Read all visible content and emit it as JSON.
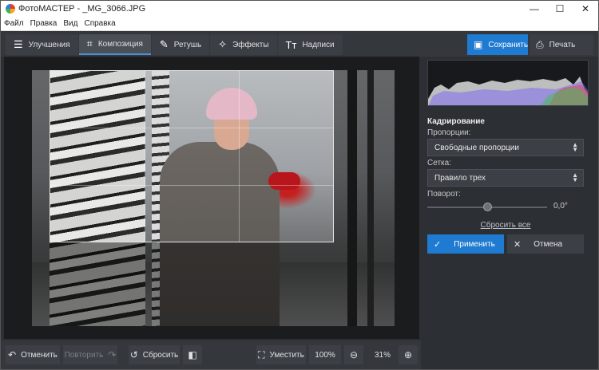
{
  "window": {
    "title": "ФотоМАСТЕР - _MG_3066.JPG",
    "minimize": "—",
    "maximize": "☐",
    "close": "✕"
  },
  "menu": [
    "Файл",
    "Правка",
    "Вид",
    "Справка"
  ],
  "tabs": [
    {
      "label": "Улучшения",
      "icon": "sliders-icon"
    },
    {
      "label": "Композиция",
      "icon": "crop-icon",
      "active": true
    },
    {
      "label": "Ретушь",
      "icon": "brush-icon"
    },
    {
      "label": "Эффекты",
      "icon": "magic-wand-icon"
    },
    {
      "label": "Надписи",
      "icon": "text-icon"
    }
  ],
  "toolbar": {
    "save_label": "Сохранить",
    "print_label": "Печать"
  },
  "bottom": {
    "undo_label": "Отменить",
    "redo_label": "Повторить",
    "reset_label": "Сбросить",
    "fit_label": "Уместить",
    "zoom_100": "100%",
    "zoom_value": "31%"
  },
  "panel": {
    "section_title": "Кадрирование",
    "proportions_label": "Пропорции:",
    "proportions_value": "Свободные пропорции",
    "grid_label": "Сетка:",
    "grid_value": "Правило трех",
    "rotation_label": "Поворот:",
    "rotation_value": "0,0°",
    "reset_all": "Сбросить все",
    "apply_label": "Применить",
    "cancel_label": "Отмена"
  },
  "colors": {
    "accent": "#1f7ad1",
    "panel_bg": "#2c2f34",
    "canvas_bg": "#1b1c1e"
  }
}
